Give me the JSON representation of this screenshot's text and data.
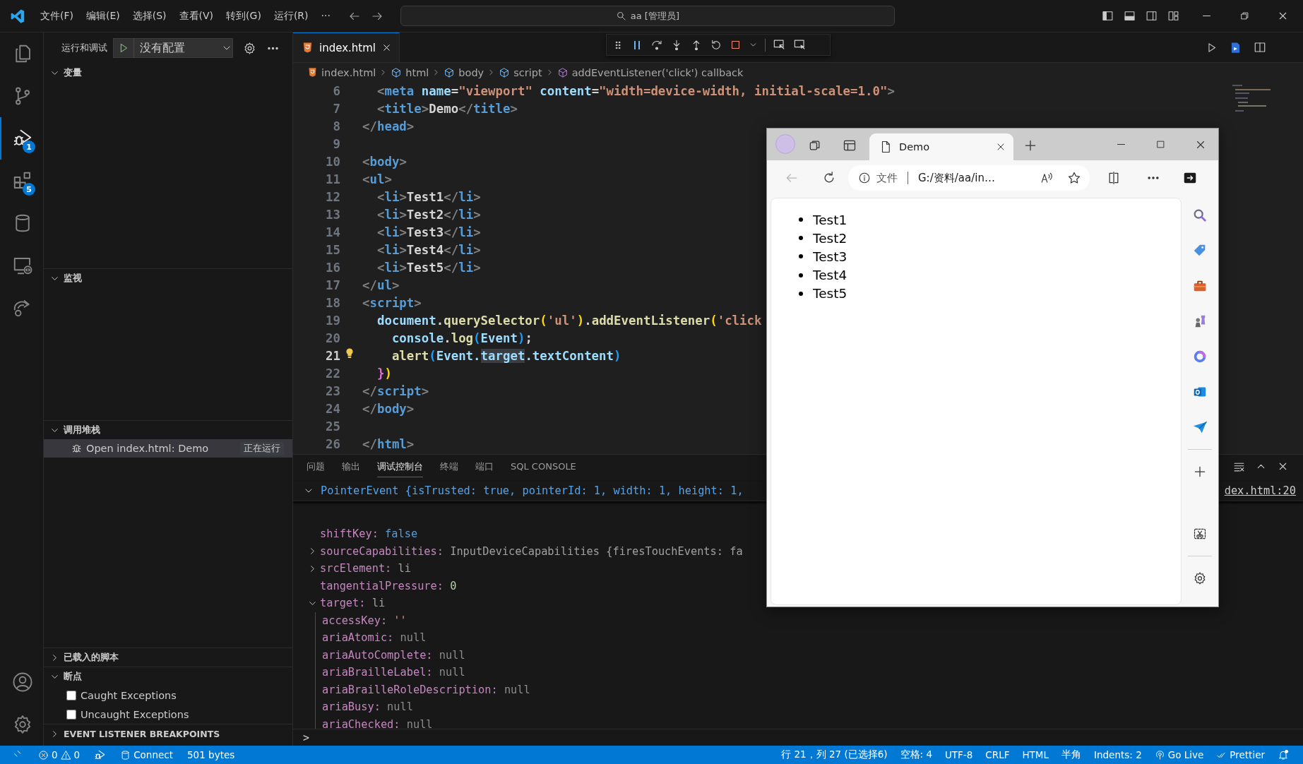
{
  "title_bar": {
    "menus": [
      "文件(F)",
      "编辑(E)",
      "选择(S)",
      "查看(V)",
      "转到(G)",
      "运行(R)",
      "···"
    ],
    "command_center": "aa [管理员]"
  },
  "activity_bar": {
    "items": [
      {
        "selected": false
      },
      {
        "selected": false
      },
      {
        "selected": true,
        "badge": "1"
      },
      {
        "selected": false,
        "badge": "5"
      },
      {
        "selected": false
      },
      {
        "selected": false
      },
      {
        "selected": false
      }
    ]
  },
  "sidebar": {
    "title": "运行和调试",
    "configuration": "没有配置",
    "sections": [
      {
        "title": "变量",
        "expanded": true
      },
      {
        "title": "监视",
        "expanded": true
      },
      {
        "title": "调用堆栈",
        "expanded": true,
        "items": [
          {
            "label": "Open index.html: Demo",
            "status": "正在运行",
            "selected": true
          }
        ]
      },
      {
        "title": "已载入的脚本",
        "expanded": false
      },
      {
        "title": "断点",
        "expanded": true,
        "checkboxes": [
          {
            "label": "Caught Exceptions",
            "checked": false
          },
          {
            "label": "Uncaught Exceptions",
            "checked": false
          }
        ]
      },
      {
        "title": "EVENT LISTENER BREAKPOINTS",
        "expanded": false
      }
    ]
  },
  "editor": {
    "tabs": [
      {
        "label": "index.html",
        "selected": true
      }
    ],
    "breadcrumbs": [
      {
        "label": "index.html",
        "kind": "file"
      },
      {
        "label": "html",
        "kind": "element"
      },
      {
        "label": "body",
        "kind": "element"
      },
      {
        "label": "script",
        "kind": "element"
      },
      {
        "label": "addEventListener('click') callback",
        "kind": "function"
      }
    ],
    "lines": [
      {
        "number": "6",
        "current": false,
        "tokens": [
          {
            "text": "  <",
            "kind": "punct"
          },
          {
            "text": "meta",
            "kind": "tag"
          },
          {
            "text": " name",
            "kind": "attr"
          },
          {
            "text": "=",
            "kind": "text"
          },
          {
            "text": "\"viewport\"",
            "kind": "string"
          },
          {
            "text": " content",
            "kind": "attr"
          },
          {
            "text": "=",
            "kind": "text"
          },
          {
            "text": "\"width=device-width, initial-scale=1.0\"",
            "kind": "string"
          },
          {
            "text": ">",
            "kind": "punct"
          }
        ]
      },
      {
        "number": "7",
        "current": false,
        "tokens": [
          {
            "text": "  <",
            "kind": "punct"
          },
          {
            "text": "title",
            "kind": "tag"
          },
          {
            "text": ">",
            "kind": "punct"
          },
          {
            "text": "Demo",
            "kind": "text"
          },
          {
            "text": "</",
            "kind": "punct"
          },
          {
            "text": "title",
            "kind": "tag"
          },
          {
            "text": ">",
            "kind": "punct"
          }
        ]
      },
      {
        "number": "8",
        "current": false,
        "tokens": [
          {
            "text": "</",
            "kind": "punct"
          },
          {
            "text": "head",
            "kind": "tag"
          },
          {
            "text": ">",
            "kind": "punct"
          }
        ]
      },
      {
        "number": "9",
        "current": false
      },
      {
        "number": "10",
        "current": false,
        "tokens": [
          {
            "text": "<",
            "kind": "punct"
          },
          {
            "text": "body",
            "kind": "tag"
          },
          {
            "text": ">",
            "kind": "punct"
          }
        ]
      },
      {
        "number": "11",
        "current": false,
        "tokens": [
          {
            "text": "<",
            "kind": "punct"
          },
          {
            "text": "ul",
            "kind": "tag"
          },
          {
            "text": ">",
            "kind": "punct"
          }
        ]
      },
      {
        "number": "12",
        "current": false,
        "tokens": [
          {
            "text": "  <",
            "kind": "punct"
          },
          {
            "text": "li",
            "kind": "tag"
          },
          {
            "text": ">",
            "kind": "punct"
          },
          {
            "text": "Test1",
            "kind": "text"
          },
          {
            "text": "</",
            "kind": "punct"
          },
          {
            "text": "li",
            "kind": "tag"
          },
          {
            "text": ">",
            "kind": "punct"
          }
        ]
      },
      {
        "number": "13",
        "current": false,
        "tokens": [
          {
            "text": "  <",
            "kind": "punct"
          },
          {
            "text": "li",
            "kind": "tag"
          },
          {
            "text": ">",
            "kind": "punct"
          },
          {
            "text": "Test2",
            "kind": "text"
          },
          {
            "text": "</",
            "kind": "punct"
          },
          {
            "text": "li",
            "kind": "tag"
          },
          {
            "text": ">",
            "kind": "punct"
          }
        ]
      },
      {
        "number": "14",
        "current": false,
        "tokens": [
          {
            "text": "  <",
            "kind": "punct"
          },
          {
            "text": "li",
            "kind": "tag"
          },
          {
            "text": ">",
            "kind": "punct"
          },
          {
            "text": "Test3",
            "kind": "text"
          },
          {
            "text": "</",
            "kind": "punct"
          },
          {
            "text": "li",
            "kind": "tag"
          },
          {
            "text": ">",
            "kind": "punct"
          }
        ]
      },
      {
        "number": "15",
        "current": false,
        "tokens": [
          {
            "text": "  <",
            "kind": "punct"
          },
          {
            "text": "li",
            "kind": "tag"
          },
          {
            "text": ">",
            "kind": "punct"
          },
          {
            "text": "Test4",
            "kind": "text"
          },
          {
            "text": "</",
            "kind": "punct"
          },
          {
            "text": "li",
            "kind": "tag"
          },
          {
            "text": ">",
            "kind": "punct"
          }
        ]
      },
      {
        "number": "16",
        "current": false,
        "tokens": [
          {
            "text": "  <",
            "kind": "punct"
          },
          {
            "text": "li",
            "kind": "tag"
          },
          {
            "text": ">",
            "kind": "punct"
          },
          {
            "text": "Test5",
            "kind": "text"
          },
          {
            "text": "</",
            "kind": "punct"
          },
          {
            "text": "li",
            "kind": "tag"
          },
          {
            "text": ">",
            "kind": "punct"
          }
        ]
      },
      {
        "number": "17",
        "current": false,
        "tokens": [
          {
            "text": "</",
            "kind": "punct"
          },
          {
            "text": "ul",
            "kind": "tag"
          },
          {
            "text": ">",
            "kind": "punct"
          }
        ]
      },
      {
        "number": "18",
        "current": false,
        "tokens": [
          {
            "text": "<",
            "kind": "punct"
          },
          {
            "text": "script",
            "kind": "tag"
          },
          {
            "text": ">",
            "kind": "punct"
          }
        ]
      },
      {
        "number": "19",
        "current": false,
        "tokens": [
          {
            "text": "  document",
            "kind": "variable"
          },
          {
            "text": ".",
            "kind": "text"
          },
          {
            "text": "querySelector",
            "kind": "function"
          },
          {
            "text": "(",
            "kind": "bracket1"
          },
          {
            "text": "'ul'",
            "kind": "string"
          },
          {
            "text": ")",
            "kind": "bracket1"
          },
          {
            "text": ".",
            "kind": "text"
          },
          {
            "text": "addEventListener",
            "kind": "function"
          },
          {
            "text": "(",
            "kind": "bracket1"
          },
          {
            "text": "'click",
            "kind": "string"
          }
        ]
      },
      {
        "number": "20",
        "current": false,
        "tokens": [
          {
            "text": "    console",
            "kind": "variable"
          },
          {
            "text": ".",
            "kind": "text"
          },
          {
            "text": "log",
            "kind": "function"
          },
          {
            "text": "(",
            "kind": "bracket2"
          },
          {
            "text": "Event",
            "kind": "variable"
          },
          {
            "text": ")",
            "kind": "bracket2"
          },
          {
            "text": ";",
            "kind": "text"
          }
        ]
      },
      {
        "number": "21",
        "current": true,
        "tokens": [
          {
            "text": "    alert",
            "kind": "function"
          },
          {
            "text": "(",
            "kind": "bracket2"
          },
          {
            "text": "Event.",
            "kind": "variable"
          },
          {
            "text": "target",
            "kind": "match"
          },
          {
            "text": ".textContent",
            "kind": "variable"
          },
          {
            "text": ")",
            "kind": "bracket2"
          }
        ]
      },
      {
        "number": "22",
        "current": false,
        "tokens": [
          {
            "text": "  }",
            "kind": "bracket3"
          },
          {
            "text": ")",
            "kind": "bracket1"
          }
        ]
      },
      {
        "number": "23",
        "current": false,
        "tokens": [
          {
            "text": "</",
            "kind": "punct"
          },
          {
            "text": "script",
            "kind": "tag"
          },
          {
            "text": ">",
            "kind": "punct"
          }
        ]
      },
      {
        "number": "24",
        "current": false,
        "tokens": [
          {
            "text": "</",
            "kind": "punct"
          },
          {
            "text": "body",
            "kind": "tag"
          },
          {
            "text": ">",
            "kind": "punct"
          }
        ]
      },
      {
        "number": "25",
        "current": false
      },
      {
        "number": "26",
        "current": false,
        "tokens": [
          {
            "text": "</",
            "kind": "punct"
          },
          {
            "text": "html",
            "kind": "tag"
          },
          {
            "text": ">",
            "kind": "punct"
          }
        ]
      }
    ]
  },
  "panel": {
    "tabs": [
      {
        "label": "问题",
        "selected": false
      },
      {
        "label": "输出",
        "selected": false
      },
      {
        "label": "调试控制台",
        "selected": true
      },
      {
        "label": "终端",
        "selected": false
      },
      {
        "label": "端口",
        "selected": false
      },
      {
        "label": "SQL CONSOLE",
        "selected": false
      }
    ],
    "console": {
      "summary": "PointerEvent {isTrusted: true, pointerId: 1, width: 1, height: 1,",
      "source": "dex.html:20",
      "expanded": true,
      "properties": [
        {
          "key": "shiftKey:",
          "value": "false",
          "kind": "keyword"
        },
        {
          "key": "sourceCapabilities:",
          "value": "InputDeviceCapabilities {firesTouchEvents: fa",
          "kind": "object",
          "expanded": false
        },
        {
          "key": "srcElement:",
          "value": "li",
          "kind": "object",
          "expanded": false
        },
        {
          "key": "tangentialPressure:",
          "value": "0",
          "kind": "number"
        },
        {
          "key": "target:",
          "value": "li",
          "kind": "object",
          "expanded": true,
          "children": [
            {
              "key": "accessKey:",
              "value": "''",
              "kind": "string"
            },
            {
              "key": "ariaAtomic:",
              "value": "null",
              "kind": "null"
            },
            {
              "key": "ariaAutoComplete:",
              "value": "null",
              "kind": "null"
            },
            {
              "key": "ariaBrailleLabel:",
              "value": "null",
              "kind": "null"
            },
            {
              "key": "ariaBrailleRoleDescription:",
              "value": "null",
              "kind": "null"
            },
            {
              "key": "ariaBusy:",
              "value": "null",
              "kind": "null"
            },
            {
              "key": "ariaChecked:",
              "value": "null",
              "kind": "null"
            }
          ]
        }
      ]
    },
    "prompt": ">"
  },
  "browser": {
    "tabs": [
      {
        "title": "Demo",
        "selected": true
      }
    ],
    "address": {
      "scheme": "文件",
      "url": "G:/资料/aa/in…"
    },
    "page": {
      "items": [
        "Test1",
        "Test2",
        "Test3",
        "Test4",
        "Test5"
      ]
    }
  },
  "status_bar": {
    "errors": "0",
    "warnings": "0",
    "connection": "Connect",
    "file_size": "501 bytes",
    "cursor": "行 21，列 27 (已选择6)",
    "spaces": "空格: 4",
    "encoding": "UTF-8",
    "eol": "CRLF",
    "language": "HTML",
    "width_mode": "半角",
    "indents": "Indents: 2",
    "live_server": "Go Live",
    "formatter": "Prettier"
  }
}
